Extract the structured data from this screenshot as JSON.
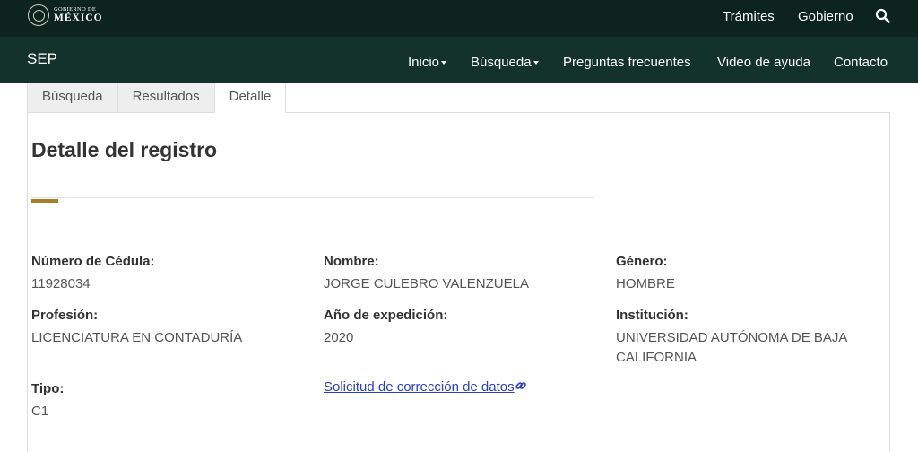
{
  "topbar": {
    "logo_small": "GOBIERNO DE",
    "logo_big": "MÉXICO",
    "links": [
      "Trámites",
      "Gobierno"
    ],
    "search_icon": "search-icon"
  },
  "navbar": {
    "brand": "SEP",
    "items": [
      {
        "label": "Inicio",
        "dropdown": true
      },
      {
        "label": "Búsqueda",
        "dropdown": true
      },
      {
        "label": "Preguntas frecuentes",
        "dropdown": false
      },
      {
        "label": "Video de ayuda",
        "dropdown": false
      },
      {
        "label": "Contacto",
        "dropdown": false
      }
    ]
  },
  "tabs": [
    {
      "label": "Búsqueda",
      "active": false
    },
    {
      "label": "Resultados",
      "active": false
    },
    {
      "label": "Detalle",
      "active": true
    }
  ],
  "detail": {
    "title": "Detalle del registro",
    "fields": {
      "cedula": {
        "label": "Número de Cédula:",
        "value": "11928034"
      },
      "nombre": {
        "label": "Nombre:",
        "value": "JORGE CULEBRO VALENZUELA"
      },
      "genero": {
        "label": "Género:",
        "value": "HOMBRE"
      },
      "profesion": {
        "label": "Profesión:",
        "value": "LICENCIATURA EN CONTADURÍA"
      },
      "anio": {
        "label": "Año de expedición:",
        "value": "2020"
      },
      "institucion": {
        "label": "Institución:",
        "value": "UNIVERSIDAD AUTÓNOMA DE BAJA CALIFORNIA"
      },
      "tipo": {
        "label": "Tipo:",
        "value": "C1"
      }
    },
    "correction_link": "Solicitud de corrección de datos",
    "link_icon": "link-icon"
  },
  "colors": {
    "topbar_bg": "#0c231e",
    "navbar_bg": "#13322b",
    "accent": "#a57f2c",
    "link": "#2b3fbf"
  }
}
